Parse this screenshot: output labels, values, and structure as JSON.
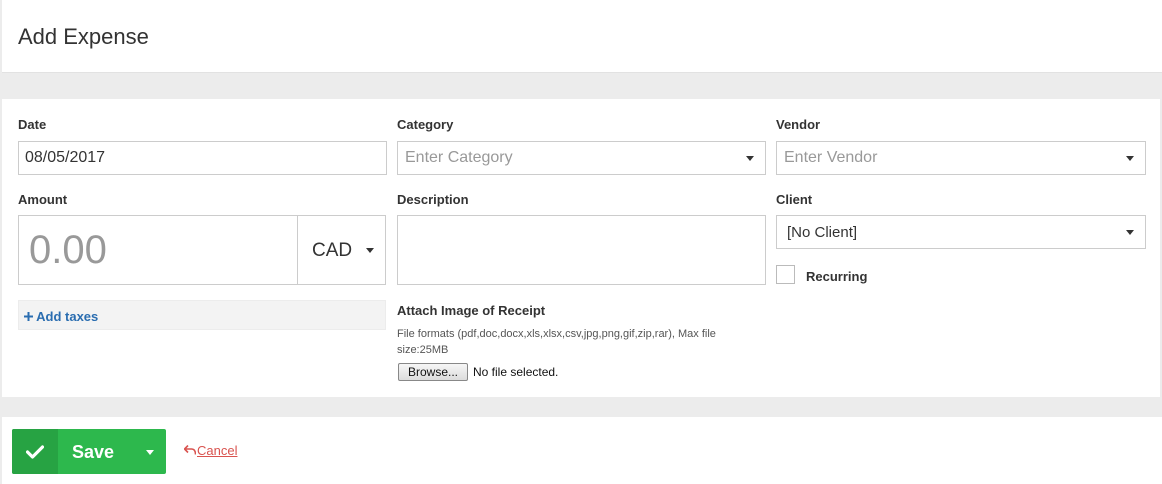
{
  "header": {
    "title": "Add Expense"
  },
  "form": {
    "date": {
      "label": "Date",
      "value": "08/05/2017"
    },
    "category": {
      "label": "Category",
      "placeholder": "Enter Category"
    },
    "vendor": {
      "label": "Vendor",
      "placeholder": "Enter Vendor"
    },
    "amount": {
      "label": "Amount",
      "value": "0.00",
      "currency": "CAD"
    },
    "description": {
      "label": "Description",
      "value": ""
    },
    "client": {
      "label": "Client",
      "value": "[No Client]"
    },
    "recurring": {
      "label": "Recurring",
      "checked": false
    },
    "taxes": {
      "link": "Add taxes",
      "icon": "plus-icon"
    },
    "receipt": {
      "label": "Attach Image of Receipt",
      "hint": "File formats (pdf,doc,docx,xls,xlsx,csv,jpg,png,gif,zip,rar), Max file size:25MB",
      "browse": "Browse...",
      "status": "No file selected."
    }
  },
  "footer": {
    "save": "Save",
    "cancel": "Cancel",
    "colors": {
      "save": "#2db84d",
      "save_dark": "#27a343",
      "cancel": "#d9534f"
    }
  }
}
